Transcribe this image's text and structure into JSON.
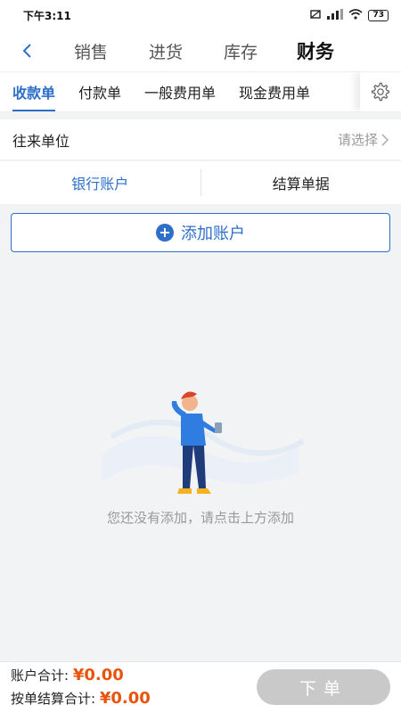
{
  "status_bar": {
    "time": "下午3:11",
    "battery": "73"
  },
  "top_nav": {
    "tabs": [
      {
        "label": "销售"
      },
      {
        "label": "进货"
      },
      {
        "label": "库存"
      },
      {
        "label": "财务"
      }
    ],
    "active_index": 3
  },
  "sub_tabs": {
    "items": [
      {
        "label": "收款单"
      },
      {
        "label": "付款单"
      },
      {
        "label": "一般费用单"
      },
      {
        "label": "现金费用单"
      }
    ],
    "active_index": 0
  },
  "partner": {
    "label": "往来单位",
    "placeholder": "请选择"
  },
  "segment": {
    "items": [
      {
        "label": "银行账户"
      },
      {
        "label": "结算单据"
      }
    ],
    "active_index": 0
  },
  "add_account": {
    "label": "添加账户"
  },
  "empty_state": {
    "message": "您还没有添加，请点击上方添加"
  },
  "footer": {
    "account_total_label": "账户合计:",
    "account_total_value": "¥0.00",
    "settle_total_label": "按单结算合计:",
    "settle_total_value": "¥0.00",
    "submit_label": "下单"
  },
  "colors": {
    "accent": "#2e6fc9",
    "amount": "#e8540d",
    "disabled": "#c9c9c9"
  }
}
